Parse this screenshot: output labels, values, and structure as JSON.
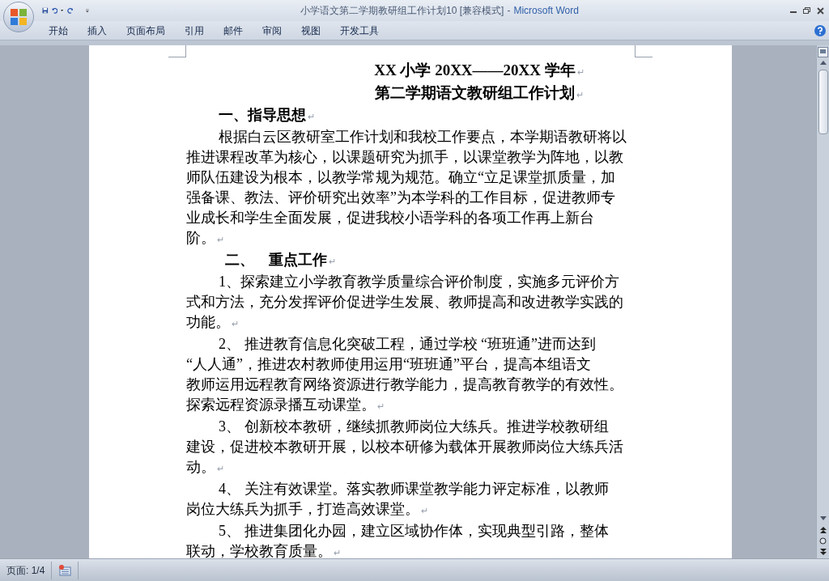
{
  "window": {
    "title": "小学语文第二学期教研组工作计划10 [兼容模式]",
    "separator": "-",
    "app": "Microsoft Word"
  },
  "ribbon_tabs": [
    {
      "label": "开始",
      "selected": false
    },
    {
      "label": "插入",
      "selected": false
    },
    {
      "label": "页面布局",
      "selected": false
    },
    {
      "label": "引用",
      "selected": false
    },
    {
      "label": "邮件",
      "selected": false
    },
    {
      "label": "审阅",
      "selected": false
    },
    {
      "label": "视图",
      "selected": false
    },
    {
      "label": "开发工具",
      "selected": false
    }
  ],
  "document": {
    "paragraphs": [
      {
        "kind": "title",
        "lines": [
          "XX 小学 20XX——20XX 学年"
        ],
        "end_mark": "↵"
      },
      {
        "kind": "title",
        "lines": [
          "第二学期语文教研组工作计划"
        ],
        "end_mark": "↵"
      },
      {
        "kind": "heading",
        "lines": [
          "一、指导思想"
        ],
        "end_mark": "↵"
      },
      {
        "kind": "body",
        "lines": [
          "根据白云区教研室工作计划和我校工作要点，本学期语教研将以",
          "推进课程改革为核心，以课题研究为抓手，以课堂教学为阵地，以教",
          "师队伍建设为根本，以教学常规为规范。确立“立足课堂抓质量，加",
          "强备课、教法、评价研究出效率”为本学科的工作目标，促进教师专",
          "业成长和学生全面发展，促进我校小语学科的各项工作再上新台",
          "阶。"
        ],
        "end_mark": "↵"
      },
      {
        "kind": "heading2",
        "lines": [
          "二、　重点工作"
        ],
        "end_mark": "↵"
      },
      {
        "kind": "body",
        "lines": [
          "1、探索建立小学教育教学质量综合评价制度，实施多元评价方",
          "式和方法，充分发挥评价促进学生发展、教师提高和改进教学实践的",
          "功能。"
        ],
        "end_mark": "↵"
      },
      {
        "kind": "body",
        "lines": [
          "2、 推进教育信息化突破工程，通过学校 “班班通”进而达到",
          "“人人通”，推进农村教师使用运用“班班通”平台，提高本组语文",
          "教师运用远程教育网络资源进行教学能力，提高教育教学的有效性。",
          "探索远程资源录播互动课堂。"
        ],
        "end_mark": "↵"
      },
      {
        "kind": "body",
        "lines": [
          "3、 创新校本教研，继续抓教师岗位大练兵。推进学校教研组",
          "建设，促进校本教研开展，以校本研修为载体开展教师岗位大练兵活",
          "动。"
        ],
        "end_mark": "↵"
      },
      {
        "kind": "body",
        "lines": [
          "4、 关注有效课堂。落实教师课堂教学能力评定标准，以教师",
          "岗位大练兵为抓手，打造高效课堂。"
        ],
        "end_mark": "↵"
      },
      {
        "kind": "body",
        "lines": [
          "5、 推进集团化办园，建立区域协作体，实现典型引路，整体",
          "联动，学校教育质量。"
        ],
        "end_mark": "↵"
      }
    ]
  },
  "status_bar": {
    "page": "页面: 1/4"
  }
}
